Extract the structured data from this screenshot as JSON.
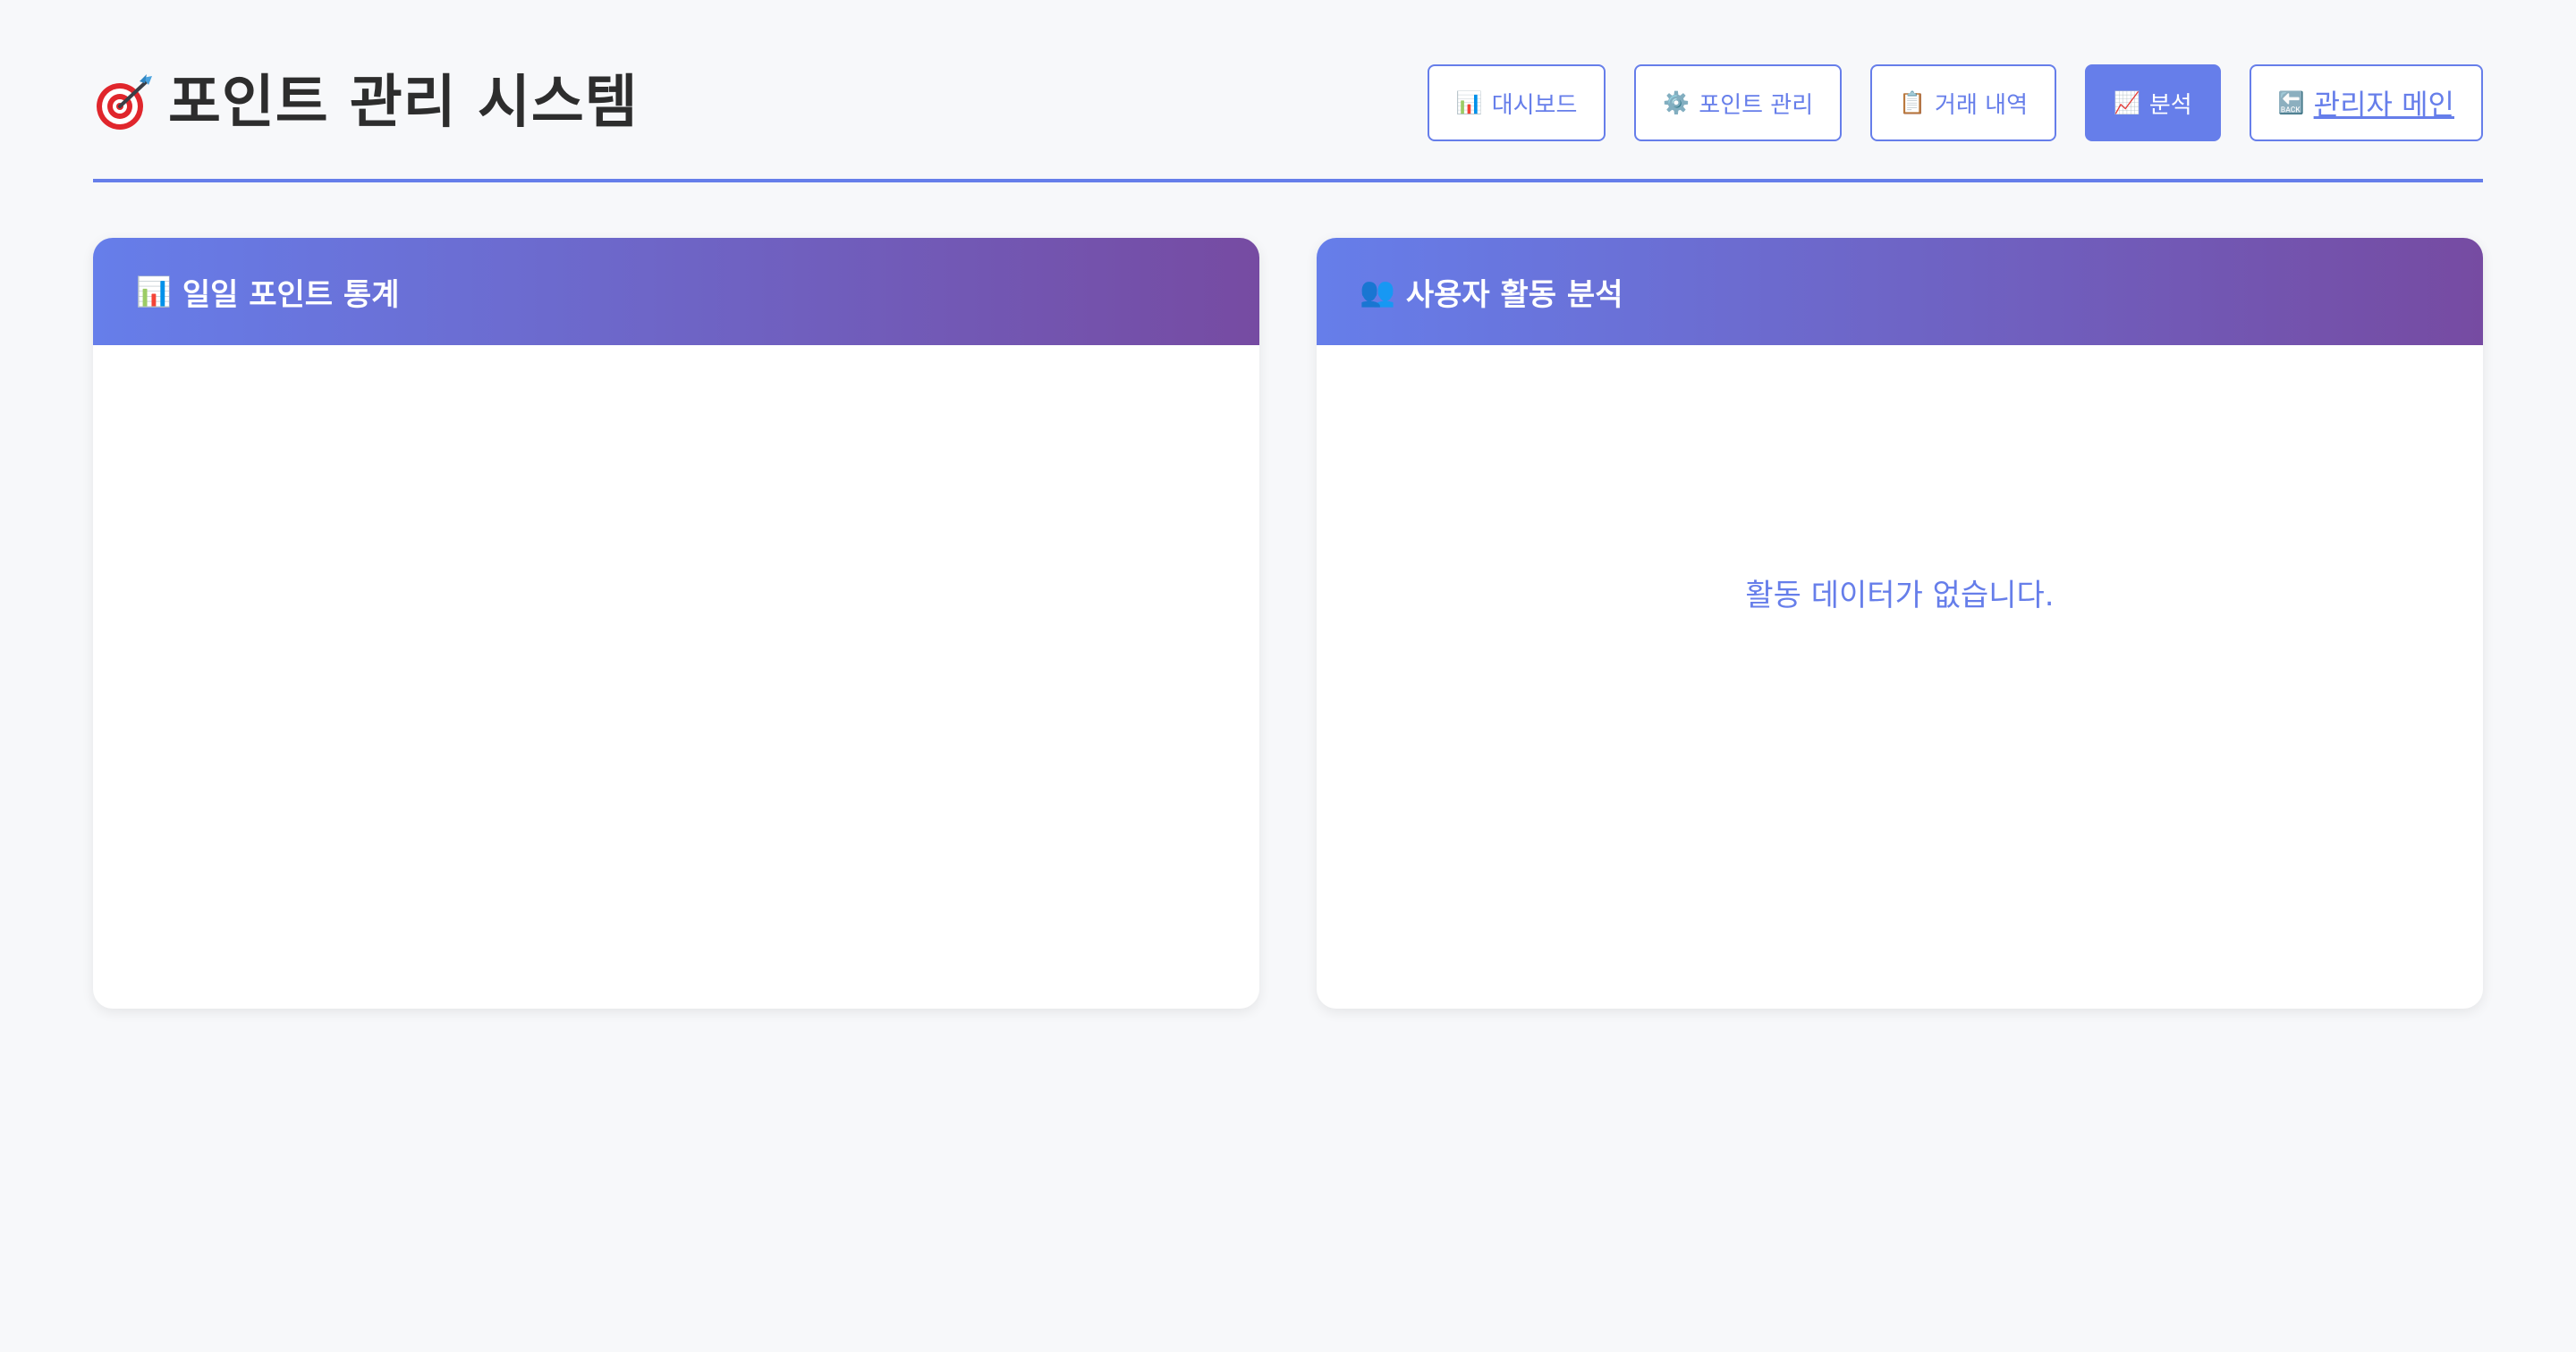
{
  "app": {
    "title": "포인트 관리 시스템",
    "logo_icon": "target-dart-icon"
  },
  "nav": {
    "items": [
      {
        "icon": "📊",
        "icon_name": "bar-chart-icon",
        "label": "대시보드",
        "active": false
      },
      {
        "icon": "⚙️",
        "icon_name": "gear-icon",
        "label": "포인트 관리",
        "active": false
      },
      {
        "icon": "📋",
        "icon_name": "clipboard-icon",
        "label": "거래 내역",
        "active": false
      },
      {
        "icon": "📈",
        "icon_name": "trending-up-icon",
        "label": "분석",
        "active": true
      },
      {
        "icon": "🔙",
        "icon_name": "back-arrow-icon",
        "label": "관리자 메인",
        "active": false
      }
    ]
  },
  "panels": {
    "daily": {
      "icon": "📊",
      "icon_name": "bar-chart-icon",
      "title": "일일 포인트 통계"
    },
    "activity": {
      "icon": "👥",
      "icon_name": "users-icon",
      "title": "사용자 활동 분석",
      "empty_message": "활동 데이터가 없습니다."
    }
  },
  "colors": {
    "accent": "#667eea",
    "gradient_start": "#667eea",
    "gradient_end": "#764ba2",
    "background": "#f7f8fa"
  }
}
